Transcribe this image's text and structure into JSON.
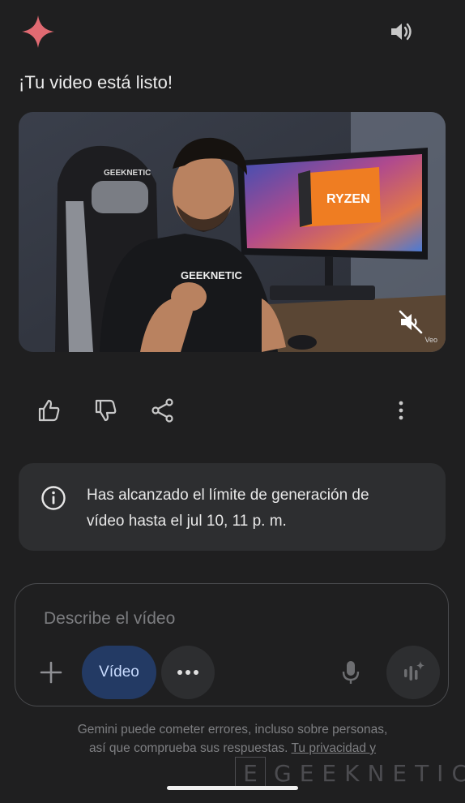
{
  "header": {
    "logo_icon": "gemini-spark-icon",
    "speaker_icon": "volume-icon"
  },
  "message": {
    "title": "¡Tu video está listo!"
  },
  "video": {
    "chair_brand": "GEEKNETIC",
    "shirt_brand": "GEEKNETIC",
    "box_label": "RYZEN",
    "mute_icon": "volume-off-icon",
    "tag": "Veo"
  },
  "actions": {
    "like_icon": "thumbs-up-icon",
    "dislike_icon": "thumbs-down-icon",
    "share_icon": "share-icon",
    "more_icon": "more-vertical-icon"
  },
  "notice": {
    "icon": "info-icon",
    "line1": "Has alcanzado el límite de generación de",
    "line2": "vídeo hasta el jul 10, 11 p. m."
  },
  "composer": {
    "placeholder": "Describe el vídeo",
    "video_chip": "Vídeo",
    "plus_icon": "plus-icon",
    "more_icon": "more-horizontal-icon",
    "mic_icon": "microphone-icon",
    "live_icon": "gemini-live-icon"
  },
  "disclaimer": {
    "line1": "Gemini puede cometer errores, incluso sobre personas,",
    "line2_prefix": "así que comprueba sus respuestas.",
    "line2_link": "Tu privacidad y"
  },
  "watermark": {
    "letter": "E",
    "text": "GEEKNETIC"
  },
  "colors": {
    "background": "#1f1f20",
    "card": "#2d2e30",
    "chip_accent": "#233a64",
    "spark": "#e06a72"
  }
}
